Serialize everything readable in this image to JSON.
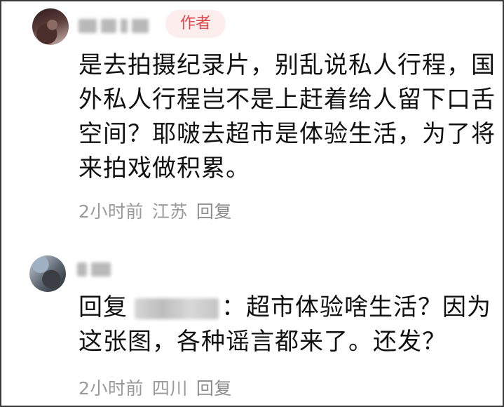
{
  "comments": [
    {
      "author_badge": "作者",
      "text": "是去拍摄纪录片，别乱说私人行程，国外私人行程岂不是上赶着给人留下口舌空间？耶啵去超市是体验生活，为了将来拍戏做积累。",
      "time": "2小时前",
      "location": "江苏",
      "reply_label": "回复"
    },
    {
      "reply_prefix": "回复",
      "text": "：超市体验啥生活？因为这张图，各种谣言都来了。还发？",
      "time": "2小时前",
      "location": "四川",
      "reply_label": "回复"
    }
  ]
}
